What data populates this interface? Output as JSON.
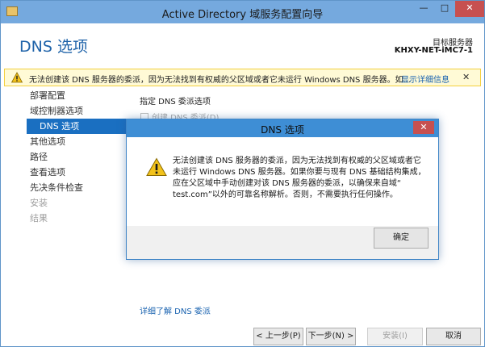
{
  "window": {
    "title": "Active Directory 域服务配置向导",
    "min_glyph": "—",
    "max_glyph": "□",
    "close_glyph": "✕"
  },
  "header": {
    "page_title": "DNS 选项",
    "target_label": "目标服务器",
    "target_server": "KHXY-NET-iMC7-1"
  },
  "warning_bar": {
    "text": "无法创建该 DNS 服务器的委派，因为无法找到有权威的父区域或者它未运行 Windows DNS 服务器。如...",
    "details_link": "显示详细信息",
    "close_glyph": "✕",
    "icon": "warning-icon"
  },
  "nav": {
    "items": [
      {
        "label": "部署配置",
        "state": "normal",
        "sub": false
      },
      {
        "label": "域控制器选项",
        "state": "normal",
        "sub": false
      },
      {
        "label": "DNS 选项",
        "state": "selected",
        "sub": true
      },
      {
        "label": "其他选项",
        "state": "normal",
        "sub": false
      },
      {
        "label": "路径",
        "state": "normal",
        "sub": false
      },
      {
        "label": "查看选项",
        "state": "normal",
        "sub": false
      },
      {
        "label": "先决条件检查",
        "state": "normal",
        "sub": false
      },
      {
        "label": "安装",
        "state": "disabled",
        "sub": false
      },
      {
        "label": "结果",
        "state": "disabled",
        "sub": false
      }
    ]
  },
  "content": {
    "section_title": "指定 DNS 委派选项",
    "checkbox_label": "创建 DNS 委派(D)",
    "learn_more_link": "详细了解 DNS 委派"
  },
  "buttons": {
    "prev": "< 上一步(P)",
    "next": "下一步(N) >",
    "install": "安装(I)",
    "cancel": "取消"
  },
  "dialog": {
    "title": "DNS 选项",
    "close_glyph": "✕",
    "icon": "warning-icon",
    "message": "无法创建该 DNS 服务器的委派，因为无法找到有权威的父区域或者它\n未运行 Windows DNS 服务器。如果你要与现有 DNS 基础结构集成，\n应在父区域中手动创建对该 DNS 服务器的委派，以确保来自域“\ntest.com”以外的可靠名称解析。否则，不需要执行任何操作。",
    "ok_label": "确定"
  },
  "colors": {
    "titlebar": "#75a9de",
    "dialog_titlebar": "#3e8ed5",
    "accent": "#1a6fc1",
    "link": "#1a63b0",
    "warning_bg": "#fffad6",
    "close_red": "#c75050"
  }
}
